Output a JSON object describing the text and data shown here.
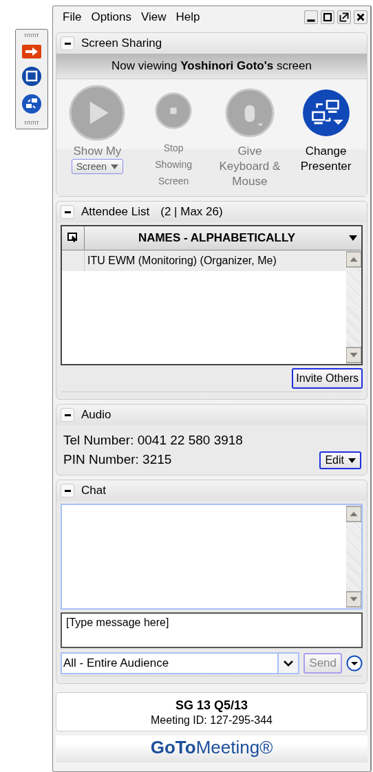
{
  "menu": [
    "File",
    "Options",
    "View",
    "Help"
  ],
  "screen_sharing": {
    "title": "Screen Sharing",
    "expanded": true,
    "banner": "Now viewing **Yoshinori Goto's** screen",
    "actions": [
      {
        "kind": "play",
        "label": "Show My",
        "dropdown": "Screen",
        "disabled": true
      },
      {
        "kind": "stop",
        "label": "Stop Showing Screen",
        "disabled": true
      },
      {
        "kind": "mouse",
        "label": "Give Keyboard & Mouse",
        "disabled": true
      },
      {
        "kind": "presenter",
        "label": "Change Presenter",
        "disabled": false
      }
    ]
  },
  "attendees": {
    "title": "Attendee List",
    "count": "(2 | Max 26)",
    "expanded": true,
    "column": "NAMES - ALPHABETICALLY",
    "rows": [
      {
        "name": "ITU EWM (Monitoring) (Organizer, Me)",
        "selected": false
      }
    ],
    "invite_button": "Invite Others"
  },
  "audio": {
    "title": "Audio",
    "expanded": true,
    "lines": [
      "Tel Number: 0041 22 580 3918",
      "PIN Number: 3215"
    ],
    "edit_button": "Edit"
  },
  "chat": {
    "title": "Chat",
    "expanded": true,
    "placeholder": "[Type message here]",
    "recipient": "All - Entire Audience",
    "send_button": "Send",
    "send_disabled": true
  },
  "footer": {
    "meeting": "SG 13 Q5/13",
    "meeting_id": "Meeting ID: 127-295-344",
    "logo": "**GoTo**Meeting®"
  }
}
